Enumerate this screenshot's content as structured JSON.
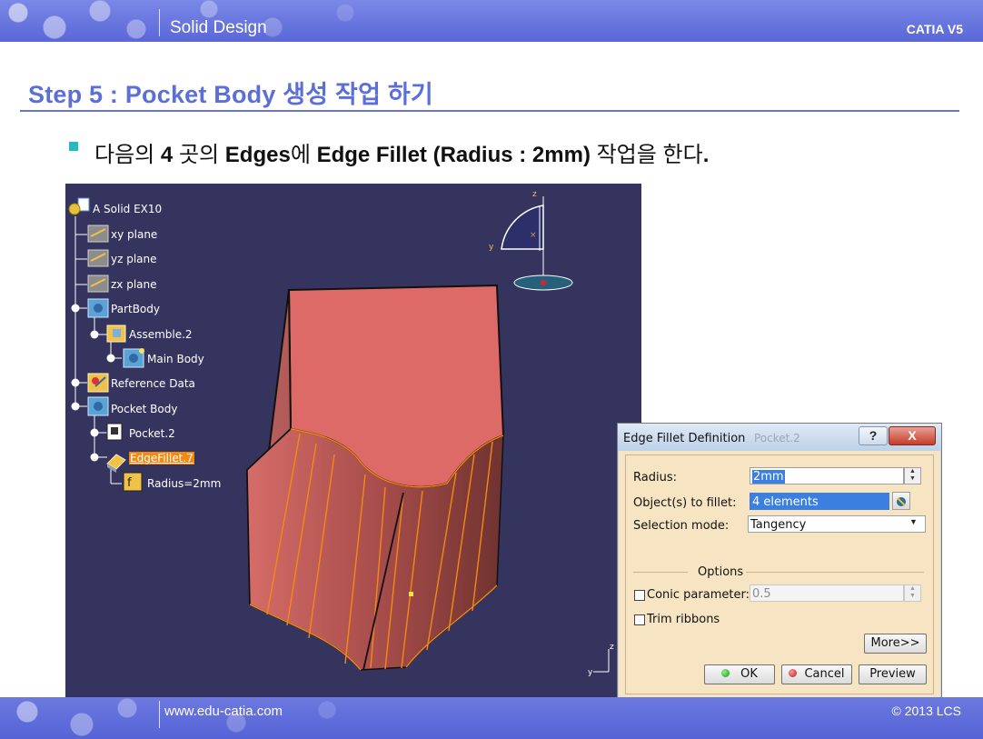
{
  "header": {
    "title": "Solid Design",
    "product": "CATIA V5"
  },
  "slide": {
    "title": "Step 5 : Pocket Body 생성 작업 하기",
    "bullet": {
      "p1": "다음의 ",
      "b1": "4",
      "p2": " 곳의 ",
      "b2": "Edges",
      "p3": "에 ",
      "b3": "Edge Fillet (Radius : 2mm)",
      "p4": " 작업을 한다",
      "end": "."
    }
  },
  "tree": {
    "items": [
      {
        "label": "A Solid EX10",
        "icon": "part-icon"
      },
      {
        "label": "xy plane",
        "icon": "plane-icon"
      },
      {
        "label": "yz plane",
        "icon": "plane-icon"
      },
      {
        "label": "zx plane",
        "icon": "plane-icon"
      },
      {
        "label": "PartBody",
        "icon": "body-icon"
      },
      {
        "label": "Assemble.2",
        "icon": "assemble-icon"
      },
      {
        "label": "Main Body",
        "icon": "body-icon"
      },
      {
        "label": "Reference Data",
        "icon": "geoset-icon"
      },
      {
        "label": "Pocket Body",
        "icon": "body-icon"
      },
      {
        "label": "Pocket.2",
        "icon": "pocket-icon"
      },
      {
        "label": "EdgeFillet.7",
        "icon": "edge-fillet-icon",
        "selected": true
      },
      {
        "label": "Radius=2mm",
        "icon": "parameter-icon"
      }
    ]
  },
  "compass": {
    "z": "z",
    "y": "y"
  },
  "axis_triad": {
    "z": "z",
    "y": "y"
  },
  "dialog": {
    "title": "Edge Fillet Definition",
    "bg_title": "Pocket.2",
    "help": "?",
    "close": "X",
    "radius_label": "Radius:",
    "radius_value": "2mm",
    "objects_label": "Object(s) to fillet:",
    "objects_value": "4 elements",
    "selection_label": "Selection mode:",
    "selection_value": "Tangency",
    "options_label": "Options",
    "conic_label": "Conic parameter:",
    "conic_value": "0.5",
    "trim_label": "Trim ribbons",
    "more": "More>>",
    "ok": "OK",
    "cancel": "Cancel",
    "preview": "Preview"
  },
  "footer": {
    "url": "www.edu-catia.com",
    "copyright": "© 2013 LCS"
  },
  "colors": {
    "header_bg": "#5a67d8",
    "title_blue": "#5b6fd6",
    "bullet": "#27b7c5",
    "viewport_bg": "#35345f",
    "solid_face": "#d96b69",
    "fillet_edge": "#f28a12",
    "dialog_bg": "#f7e4c2",
    "selection": "#3b7fe0"
  }
}
